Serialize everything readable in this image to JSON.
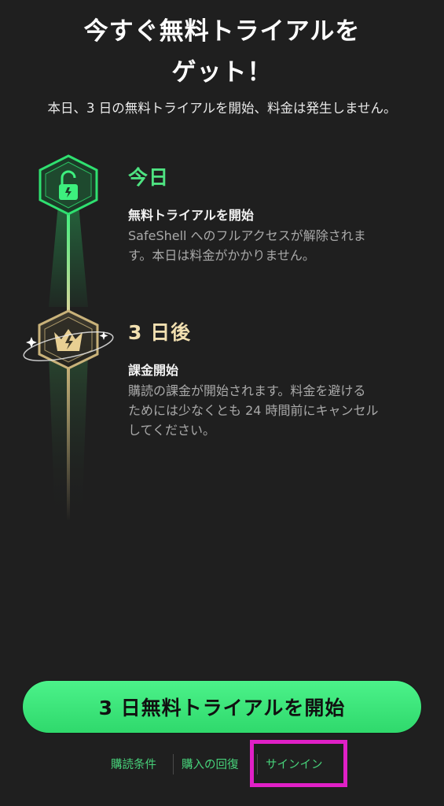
{
  "title": {
    "line1": "今すぐ無料トライアルを",
    "line2": "ゲット！"
  },
  "subtitle": "本日、3 日の無料トライアルを開始、料金は発生しません。",
  "steps": [
    {
      "when": "今日",
      "heading": "無料トライアルを開始",
      "desc_line1": "SafeShell へのフルアクセスが解除されま",
      "desc_line2": "す。本日は料金がかかりません。",
      "icon": "unlock-icon",
      "color": "#4ee281"
    },
    {
      "when": "3 日後",
      "heading": "課金開始",
      "desc_line1": "購読の課金が開始されます。料金を避ける",
      "desc_line2": "ためには少なくとも 24 時間前にキャンセル",
      "desc_line3": "してください。",
      "icon": "crown-icon",
      "color": "#f1dfb0"
    }
  ],
  "cta": {
    "label": "3 日無料トライアルを開始"
  },
  "footer": {
    "terms": "購読条件",
    "restore": "購入の回復",
    "signin": "サインイン"
  },
  "colors": {
    "background": "#1f1f1f",
    "accent": "#34e072",
    "gold": "#c9b27a",
    "highlight": "#e020c6"
  }
}
